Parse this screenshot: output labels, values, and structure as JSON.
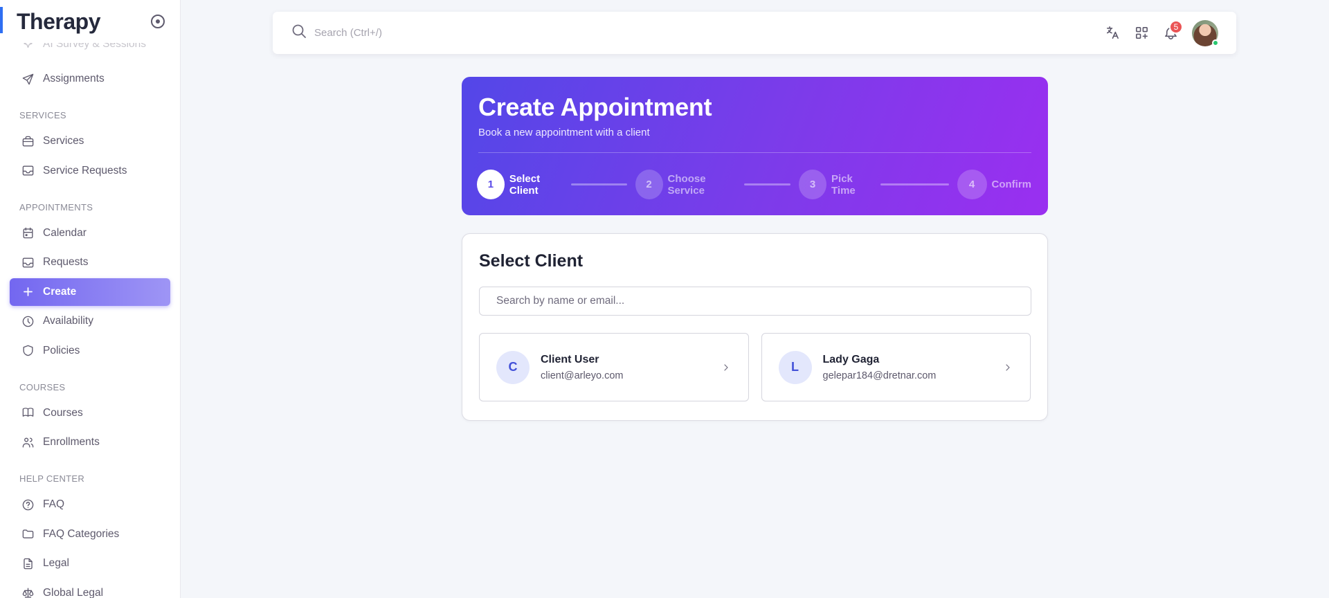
{
  "brand": {
    "title": "Therapy"
  },
  "sidebar": {
    "cut_item": "AI Survey & Sessions",
    "items_top": [
      {
        "label": "Assignments",
        "icon": "send-icon"
      }
    ],
    "sections": [
      {
        "label": "SERVICES",
        "items": [
          {
            "label": "Services",
            "icon": "briefcase-icon"
          },
          {
            "label": "Service Requests",
            "icon": "inbox-icon"
          }
        ]
      },
      {
        "label": "APPOINTMENTS",
        "items": [
          {
            "label": "Calendar",
            "icon": "calendar-icon"
          },
          {
            "label": "Requests",
            "icon": "inbox-icon"
          },
          {
            "label": "Create",
            "icon": "plus-icon",
            "active": true
          },
          {
            "label": "Availability",
            "icon": "clock-icon"
          },
          {
            "label": "Policies",
            "icon": "shield-icon"
          }
        ]
      },
      {
        "label": "COURSES",
        "items": [
          {
            "label": "Courses",
            "icon": "book-icon"
          },
          {
            "label": "Enrollments",
            "icon": "users-icon"
          }
        ]
      },
      {
        "label": "HELP CENTER",
        "items": [
          {
            "label": "FAQ",
            "icon": "help-circle-icon"
          },
          {
            "label": "FAQ Categories",
            "icon": "folder-icon"
          },
          {
            "label": "Legal",
            "icon": "file-icon"
          },
          {
            "label": "Global Legal",
            "icon": "scale-icon"
          }
        ]
      }
    ]
  },
  "topbar": {
    "search_placeholder": "Search (Ctrl+/)",
    "notification_count": "5"
  },
  "hero": {
    "title": "Create Appointment",
    "subtitle": "Book a new appointment with a client",
    "steps": [
      {
        "num": "1",
        "label": "Select Client",
        "active": true
      },
      {
        "num": "2",
        "label": "Choose Service",
        "active": false
      },
      {
        "num": "3",
        "label": "Pick Time",
        "active": false
      },
      {
        "num": "4",
        "label": "Confirm",
        "active": false
      }
    ]
  },
  "card": {
    "title": "Select Client",
    "search_placeholder": "Search by name or email...",
    "clients": [
      {
        "initial": "C",
        "name": "Client User",
        "email": "client@arleyo.com"
      },
      {
        "initial": "L",
        "name": "Lady Gaga",
        "email": "gelepar184@dretnar.com"
      }
    ]
  },
  "colors": {
    "accent": "#7367f0",
    "hero_start": "#5347e8",
    "hero_end": "#9a2ff0",
    "badge": "#ea5455",
    "online": "#28c76f"
  }
}
